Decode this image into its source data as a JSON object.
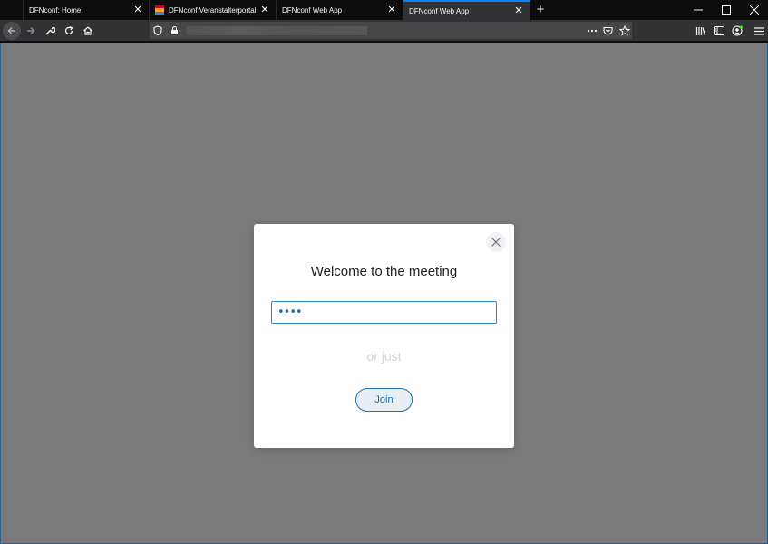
{
  "tabs": [
    {
      "label": "DFNconf: Home",
      "favicon": "none",
      "active": false
    },
    {
      "label": "DFNconf Veranstalterportal",
      "favicon": "dfn-flag-icon",
      "active": false
    },
    {
      "label": "DFNconf Web App",
      "favicon": "none",
      "active": false
    },
    {
      "label": "DFNconf Web App",
      "favicon": "none",
      "active": true
    }
  ],
  "browser": {
    "url_value": "",
    "accent_color": "#0a84ff"
  },
  "modal": {
    "title": "Welcome to the meeting",
    "pin_value": "••••",
    "or_text": "or just",
    "join_label": "Join"
  },
  "colors": {
    "overlay": "#7a7a7a",
    "primary": "#1d6fad"
  }
}
